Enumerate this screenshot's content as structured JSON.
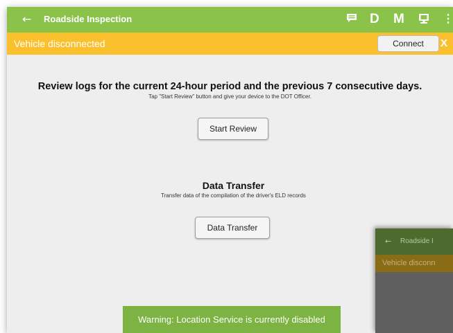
{
  "appbar": {
    "title": "Roadside Inspection",
    "back_icon": "arrow-left-icon",
    "letter_d": "D",
    "letter_m": "M",
    "more_glyph": "⋮",
    "colors": {
      "bar": "#8bc34a"
    }
  },
  "alert": {
    "text": "Vehicle disconnected",
    "connect_label": "Connect",
    "close_label": "X",
    "color": "#fbc02d"
  },
  "review": {
    "heading": "Review logs for the current 24-hour period and the previous 7 consecutive days.",
    "subtext": "Tap \"Start Review\" button and give your device to the DOT Officer.",
    "button_label": "Start Review"
  },
  "transfer": {
    "heading": "Data Transfer",
    "subtext": "Transfer data of the compilation of the driver's ELD records",
    "button_label": "Data Transfer"
  },
  "toast": {
    "text": "Warning: Location Service is currently disabled",
    "color": "#7cb342"
  },
  "overlay": {
    "title": "Roadside I",
    "alert_text": "Vehicle disconn"
  }
}
